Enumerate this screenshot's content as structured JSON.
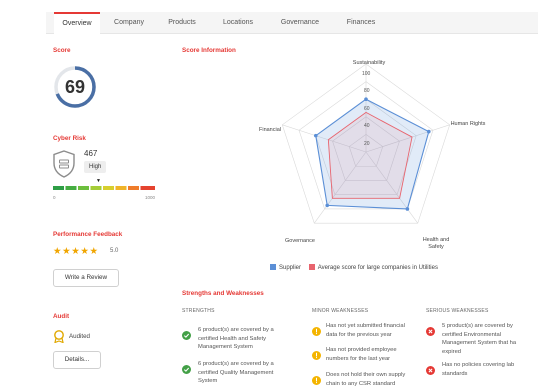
{
  "tabs": [
    {
      "label": "Overview",
      "active": true
    },
    {
      "label": "Company",
      "active": false
    },
    {
      "label": "Products",
      "active": false
    },
    {
      "label": "Locations",
      "active": false
    },
    {
      "label": "Governance",
      "active": false
    },
    {
      "label": "Finances",
      "active": false
    }
  ],
  "colors": {
    "accent": "#e53935",
    "supplier": "#5b8fd6",
    "average": "#e8646e",
    "star": "#f0a500",
    "check": "#43a047",
    "warning": "#f4b400"
  },
  "score": {
    "title": "Score",
    "value": "69"
  },
  "cyber_risk": {
    "title": "Cyber Risk",
    "value": "467",
    "level": "High",
    "min": "0",
    "max": "1000"
  },
  "performance": {
    "title": "Performance Feedback",
    "stars": "★★★★★",
    "rating": "5.0",
    "write_review": "Write a Review"
  },
  "audit": {
    "title": "Audit",
    "status": "Audited",
    "details": "Details..."
  },
  "score_info": {
    "title": "Score Information",
    "axes": [
      "Sustainability",
      "Human Rights",
      "Health and Safety",
      "Governance",
      "Financial"
    ],
    "ticks": [
      "100",
      "80",
      "60",
      "40",
      "20"
    ],
    "legend": {
      "supplier": "Supplier",
      "average": "Average score for large companies in Utilities"
    }
  },
  "chart_data": {
    "type": "radar",
    "categories": [
      "Sustainability",
      "Human Rights",
      "Health and Safety",
      "Governance",
      "Financial"
    ],
    "series": [
      {
        "name": "Supplier",
        "values": [
          60,
          75,
          80,
          75,
          60
        ]
      },
      {
        "name": "Average score for large companies in Utilities",
        "values": [
          45,
          55,
          65,
          65,
          45
        ]
      }
    ],
    "rlim": [
      0,
      100
    ],
    "ticks": [
      20,
      40,
      60,
      80,
      100
    ]
  },
  "strengths_weaknesses": {
    "title": "Strengths and Weaknesses",
    "strengths_title": "STRENGTHS",
    "minor_title": "MINOR WEAKNESSES",
    "serious_title": "SERIOUS WEAKNESSES",
    "strengths": [
      [
        "6 product(s) are covered by a",
        "certified Health and Safety",
        "Management System"
      ],
      [
        "6 product(s) are covered by a",
        "certified Quality Management",
        "System"
      ]
    ],
    "minor": [
      [
        "Has not yet submitted financial",
        "data for the previous year"
      ],
      [
        "Has not provided employee",
        "numbers for the last year"
      ],
      [
        "Does not hold their own supply",
        "chain to any CSR standard"
      ]
    ],
    "serious": [
      [
        "5 product(s) are covered by",
        "certified Environmental",
        "Management System that ha",
        "expired"
      ],
      [
        "Has no policies covering lab",
        "standards"
      ]
    ]
  }
}
